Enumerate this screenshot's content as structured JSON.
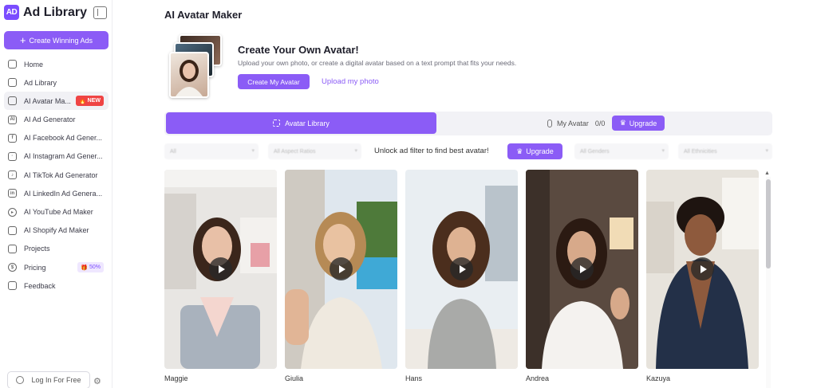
{
  "brand": {
    "logo_text": "AD",
    "name": "Ad Library"
  },
  "sidebar": {
    "create_button": "Create Winning Ads",
    "items": [
      {
        "label": "Home",
        "icon": "home-icon"
      },
      {
        "label": "Ad Library",
        "icon": "library-icon"
      },
      {
        "label": "AI Avatar Ma...",
        "icon": "avatar-icon",
        "badge": "NEW",
        "active": true
      },
      {
        "label": "AI Ad Generator",
        "icon": "ai-icon"
      },
      {
        "label": "AI Facebook Ad Gener...",
        "icon": "facebook-icon"
      },
      {
        "label": "AI Instagram Ad Gener...",
        "icon": "instagram-icon"
      },
      {
        "label": "AI TikTok Ad Generator",
        "icon": "tiktok-icon"
      },
      {
        "label": "AI LinkedIn Ad Genera...",
        "icon": "linkedin-icon"
      },
      {
        "label": "AI YouTube Ad Maker",
        "icon": "youtube-icon"
      },
      {
        "label": "AI Shopify Ad Maker",
        "icon": "shopify-icon"
      },
      {
        "label": "Projects",
        "icon": "folder-icon"
      },
      {
        "label": "Pricing",
        "icon": "pricing-icon",
        "badge": "50%"
      },
      {
        "label": "Feedback",
        "icon": "feedback-icon"
      }
    ],
    "login_button": "Log In For Free"
  },
  "main": {
    "page_title": "AI Avatar Maker",
    "hero": {
      "title": "Create Your Own Avatar!",
      "subtitle": "Upload your own photo, or create a digital avatar based on a text prompt that fits your needs.",
      "primary_button": "Create My Avatar",
      "secondary_link": "Upload my photo"
    },
    "tabs": {
      "active": "Avatar Library",
      "my_avatar": "My Avatar",
      "my_avatar_count": "0/0",
      "upgrade": "Upgrade"
    },
    "filters": {
      "f1": "All",
      "f2": "All Aspect Ratios",
      "unlock_text": "Unlock ad filter to find best avatar!",
      "upgrade": "Upgrade",
      "f3": "All Genders",
      "f4": "All Ethnicities"
    },
    "avatars": [
      {
        "name": "Maggie"
      },
      {
        "name": "Giulia"
      },
      {
        "name": "Hans"
      },
      {
        "name": "Andrea"
      },
      {
        "name": "Kazuya"
      }
    ]
  },
  "colors": {
    "accent": "#8b5cf6",
    "new_badge": "#ef4444"
  }
}
